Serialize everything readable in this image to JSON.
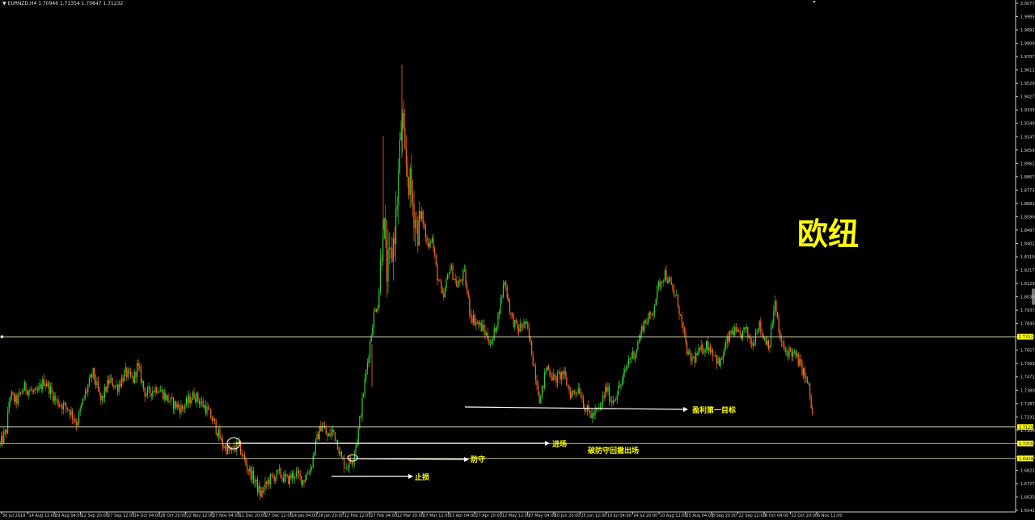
{
  "header": {
    "symbol_info": "▼ EURNZD,H4  1.70946 1.71354 1.70847 1.71232"
  },
  "title_text": "欧纽",
  "annotations": {
    "entry": "进场",
    "defense": "防守",
    "stop_loss": "止损",
    "take_profit": "盈利第一目标",
    "break_defense_exit": "破防守回撤出场"
  },
  "colors": {
    "background": "#000000",
    "bull_candle": "#36d030",
    "bear_candle": "#ff6a1a",
    "level_line": "#f0f0c8",
    "arrow": "#ffffff",
    "annotation_text": "#ffff00",
    "price_tag": "#ffff00"
  },
  "chart_data": {
    "type": "line",
    "symbol": "EURNZD",
    "timeframe": "H4",
    "y_ticks": [
      "2.00775",
      "1.99850",
      "1.98925",
      "1.98000",
      "1.97075",
      "1.96125",
      "1.95200",
      "1.94275",
      "1.93350",
      "1.92400",
      "1.91475",
      "1.90550",
      "1.89625",
      "1.88675",
      "1.87750",
      "1.86825",
      "1.85900",
      "1.84975",
      "1.84025",
      "1.83100",
      "1.82175",
      "1.81250",
      "1.80300",
      "1.79375",
      "1.78450",
      "1.77525",
      "1.76575",
      "1.75650",
      "1.74725",
      "1.73800",
      "1.72875",
      "1.71925",
      "1.71000",
      "1.70075",
      "1.69150",
      "1.68225",
      "1.67275",
      "1.66350",
      "1.65425"
    ],
    "x_ticks": [
      "30 Jul 2019",
      "14 Aug 12:00",
      "29 Aug 04:00",
      "12 Sep 20:00",
      "27 Sep 12:00",
      "14 Oct 04:00",
      "28 Oct 20:00",
      "12 Nov 12:00",
      "27 Nov 04:00",
      "11 Dec 20:00",
      "27 Dec 12:00",
      "14 Jan 04:00",
      "28 Jan 20:00",
      "12 Feb 12:00",
      "27 Feb 04:00",
      "12 Mar 20:00",
      "27 Mar 12:00",
      "13 Apr 04:00",
      "27 Apr 20:00",
      "12 May 12:00",
      "27 May 04:00",
      "10 Jun 20:00",
      "25 Jun 12:00",
      "10 Jul 04:00",
      "24 Jul 20:00",
      "10 Aug 12:00",
      "25 Aug 04:00",
      "8 Sep 20:00",
      "22 Sep 12:00",
      "8 Oct 04:00",
      "22 Oct 20:00",
      "6 Nov 12:00"
    ],
    "ylim": [
      1.65425,
      2.00775
    ],
    "price_key_points": [
      [
        0,
        1.7
      ],
      [
        8,
        1.71
      ],
      [
        12,
        1.735
      ],
      [
        20,
        1.73
      ],
      [
        30,
        1.74
      ],
      [
        45,
        1.735
      ],
      [
        55,
        1.745
      ],
      [
        70,
        1.73
      ],
      [
        85,
        1.725
      ],
      [
        95,
        1.715
      ],
      [
        105,
        1.735
      ],
      [
        115,
        1.75
      ],
      [
        125,
        1.73
      ],
      [
        135,
        1.745
      ],
      [
        145,
        1.74
      ],
      [
        155,
        1.75
      ],
      [
        165,
        1.745
      ],
      [
        170,
        1.755
      ],
      [
        180,
        1.735
      ],
      [
        195,
        1.74
      ],
      [
        210,
        1.73
      ],
      [
        225,
        1.725
      ],
      [
        240,
        1.735
      ],
      [
        255,
        1.725
      ],
      [
        265,
        1.715
      ],
      [
        275,
        1.7
      ],
      [
        285,
        1.695
      ],
      [
        295,
        1.7
      ],
      [
        305,
        1.685
      ],
      [
        315,
        1.675
      ],
      [
        322,
        1.665
      ],
      [
        332,
        1.675
      ],
      [
        345,
        1.68
      ],
      [
        355,
        1.675
      ],
      [
        365,
        1.68
      ],
      [
        375,
        1.675
      ],
      [
        385,
        1.685
      ],
      [
        390,
        1.7
      ],
      [
        398,
        1.715
      ],
      [
        405,
        1.705
      ],
      [
        412,
        1.71
      ],
      [
        418,
        1.7
      ],
      [
        422,
        1.69
      ],
      [
        428,
        1.685
      ],
      [
        436,
        1.69
      ],
      [
        442,
        1.705
      ],
      [
        448,
        1.73
      ],
      [
        455,
        1.76
      ],
      [
        462,
        1.79
      ],
      [
        468,
        1.8
      ],
      [
        474,
        1.86
      ],
      [
        478,
        1.82
      ],
      [
        484,
        1.83
      ],
      [
        490,
        1.86
      ],
      [
        494,
        1.9
      ],
      [
        497,
        1.93
      ],
      [
        500,
        1.9
      ],
      [
        504,
        1.89
      ],
      [
        510,
        1.87
      ],
      [
        516,
        1.85
      ],
      [
        522,
        1.86
      ],
      [
        528,
        1.84
      ],
      [
        534,
        1.845
      ],
      [
        540,
        1.82
      ],
      [
        548,
        1.8
      ],
      [
        556,
        1.825
      ],
      [
        566,
        1.81
      ],
      [
        574,
        1.82
      ],
      [
        582,
        1.79
      ],
      [
        590,
        1.785
      ],
      [
        598,
        1.78
      ],
      [
        608,
        1.77
      ],
      [
        616,
        1.79
      ],
      [
        624,
        1.815
      ],
      [
        632,
        1.79
      ],
      [
        640,
        1.78
      ],
      [
        650,
        1.785
      ],
      [
        656,
        1.77
      ],
      [
        662,
        1.75
      ],
      [
        668,
        1.73
      ],
      [
        676,
        1.755
      ],
      [
        686,
        1.745
      ],
      [
        696,
        1.75
      ],
      [
        706,
        1.735
      ],
      [
        716,
        1.74
      ],
      [
        724,
        1.725
      ],
      [
        732,
        1.72
      ],
      [
        742,
        1.725
      ],
      [
        750,
        1.74
      ],
      [
        756,
        1.73
      ],
      [
        762,
        1.735
      ],
      [
        770,
        1.745
      ],
      [
        778,
        1.76
      ],
      [
        786,
        1.765
      ],
      [
        796,
        1.785
      ],
      [
        806,
        1.79
      ],
      [
        814,
        1.81
      ],
      [
        822,
        1.82
      ],
      [
        830,
        1.81
      ],
      [
        838,
        1.8
      ],
      [
        846,
        1.775
      ],
      [
        852,
        1.76
      ],
      [
        858,
        1.76
      ],
      [
        866,
        1.765
      ],
      [
        874,
        1.77
      ],
      [
        882,
        1.765
      ],
      [
        890,
        1.755
      ],
      [
        898,
        1.77
      ],
      [
        906,
        1.78
      ],
      [
        914,
        1.775
      ],
      [
        922,
        1.78
      ],
      [
        930,
        1.77
      ],
      [
        938,
        1.785
      ],
      [
        944,
        1.775
      ],
      [
        952,
        1.77
      ],
      [
        958,
        1.8
      ],
      [
        964,
        1.775
      ],
      [
        970,
        1.765
      ],
      [
        978,
        1.765
      ],
      [
        986,
        1.76
      ],
      [
        994,
        1.75
      ],
      [
        1000,
        1.74
      ],
      [
        1006,
        1.715
      ]
    ],
    "horizontal_levels": [
      {
        "value": 1.77525,
        "tag": "1.77525"
      },
      {
        "value": 1.71232,
        "tag": "1.71232"
      },
      {
        "value": 1.70085,
        "tag": "1.70085"
      },
      {
        "value": 1.6904,
        "tag": "1.69040"
      }
    ],
    "side_tag": "1.80315",
    "side_tag_small": "1.79375"
  }
}
